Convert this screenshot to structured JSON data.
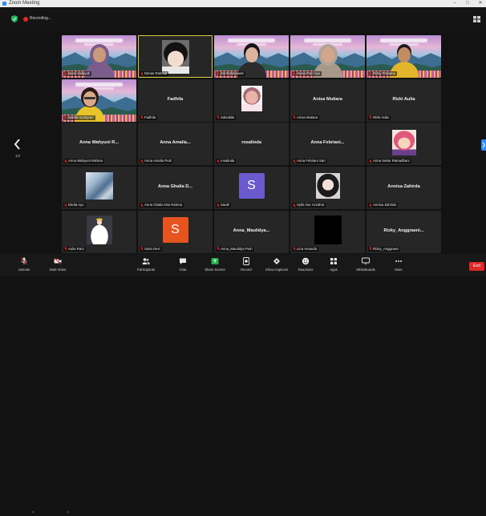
{
  "window": {
    "title": "Zoom Meeting",
    "controls": {
      "minimize": "–",
      "maximize": "□",
      "close": "✕"
    }
  },
  "topbar": {
    "security_icon": "shield-icon",
    "recording_label": "Recording...",
    "view_icon": "grid-view-icon"
  },
  "pagination": {
    "indicator": "1/2"
  },
  "colors": {
    "background": "#121212",
    "tile": "#262626",
    "active_speaker_border": "#d9d23a",
    "accent": "#2d8cff",
    "end": "#e02828",
    "share": "#24b24b",
    "muted": "#e02828"
  },
  "gallery": {
    "tiles": [
      {
        "kind": "video",
        "look": "hijab-purple",
        "name": "Nurul Hidayah"
      },
      {
        "kind": "image",
        "image": "anime-boy",
        "active": true,
        "name": "Dimas Rahmat"
      },
      {
        "kind": "video",
        "look": "dark-hair",
        "name": "Siti Rahmawati"
      },
      {
        "kind": "video",
        "look": "gray-hijab",
        "name": "Anisa Putri Ayu"
      },
      {
        "kind": "video",
        "look": "boy-yellow",
        "name": "Rizky Pratama"
      },
      {
        "kind": "video",
        "look": "glasses-yellow",
        "offset": "left",
        "name": "Nabila Syahputri"
      },
      {
        "kind": "name",
        "display": "Fadhila",
        "name": "Fadhila"
      },
      {
        "kind": "image",
        "image": "pink-avatar",
        "name": "Salsabila"
      },
      {
        "kind": "name",
        "display": "Anisa Mutiara",
        "name": "Anisa Mutiara"
      },
      {
        "kind": "name",
        "display": "Rizki Aulia",
        "name": "Rizki Aulia"
      },
      {
        "kind": "name",
        "display": "Anna Wahyuni R...",
        "name": "Anna Wahyuni Rahma"
      },
      {
        "kind": "name",
        "display": "Anna Amalia...",
        "name": "Anna Amalia Putri"
      },
      {
        "kind": "name",
        "display": "rosalinda",
        "name": "rosalinda"
      },
      {
        "kind": "name",
        "display": "Anna Febriani...",
        "name": "Anna Febriani Sari"
      },
      {
        "kind": "image",
        "image": "pixel-art",
        "name": "Anna Sekar Ramadhani"
      },
      {
        "kind": "image",
        "image": "blue-photo",
        "name": "Dinda Ayu"
      },
      {
        "kind": "name",
        "display": "Anna Ghalia D...",
        "name": "Anna Ghalia Dwi Rahma"
      },
      {
        "kind": "letter",
        "letter": "S",
        "color": "#6a5acd",
        "name": "Sarah"
      },
      {
        "kind": "image",
        "image": "anime-girl",
        "name": "Syifa Nur Azzahra"
      },
      {
        "kind": "name",
        "display": "Annisa Zahirda",
        "name": "Annisa Zahirda"
      },
      {
        "kind": "image",
        "image": "white-dress",
        "name": "Aulia Rani"
      },
      {
        "kind": "letter",
        "letter": "S",
        "color": "#e8541f",
        "name": "Sinta Devi"
      },
      {
        "kind": "name",
        "display": "Anna_Maulidya...",
        "name": "Anna_Maulidya Putri"
      },
      {
        "kind": "image",
        "image": "black",
        "name": "Lina Amanda"
      },
      {
        "kind": "name",
        "display": "Rizky_Anggraeni...",
        "name": "Rizky_Anggraeni"
      }
    ]
  },
  "toolbar": {
    "unmute": "Unmute",
    "start_video": "Start Video",
    "participants": "Participants",
    "chat": "Chat",
    "share_screen": "Share Screen",
    "record": "Record",
    "captions": "Show Captions",
    "reactions": "Reactions",
    "apps": "Apps",
    "whiteboards": "Whiteboards",
    "more": "More",
    "end": "End"
  }
}
